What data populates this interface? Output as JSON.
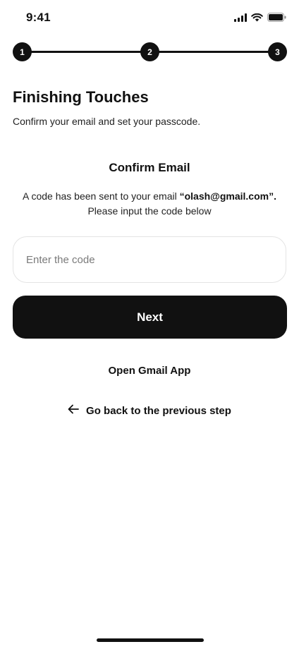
{
  "status_bar": {
    "time": "9:41",
    "icons": [
      "signal-icon",
      "wifi-icon",
      "battery-icon"
    ]
  },
  "stepper": {
    "steps": [
      "1",
      "2",
      "3"
    ],
    "current_step": 3
  },
  "header": {
    "title": "Finishing Touches",
    "subtitle": "Confirm your email and set your passcode."
  },
  "confirm": {
    "title": "Confirm Email",
    "line1_prefix": "A code has been sent to your email ",
    "email": "“olash@gmail.com”.",
    "line2": "Please input the code below"
  },
  "code_input": {
    "placeholder": "Enter the code",
    "value": ""
  },
  "actions": {
    "next_label": "Next",
    "open_gmail_label": "Open Gmail App",
    "back_label": "Go back to the previous step"
  },
  "colors": {
    "primary": "#111111",
    "background": "#ffffff",
    "input_border": "#e4e4e4",
    "placeholder": "#7a7a7a"
  }
}
